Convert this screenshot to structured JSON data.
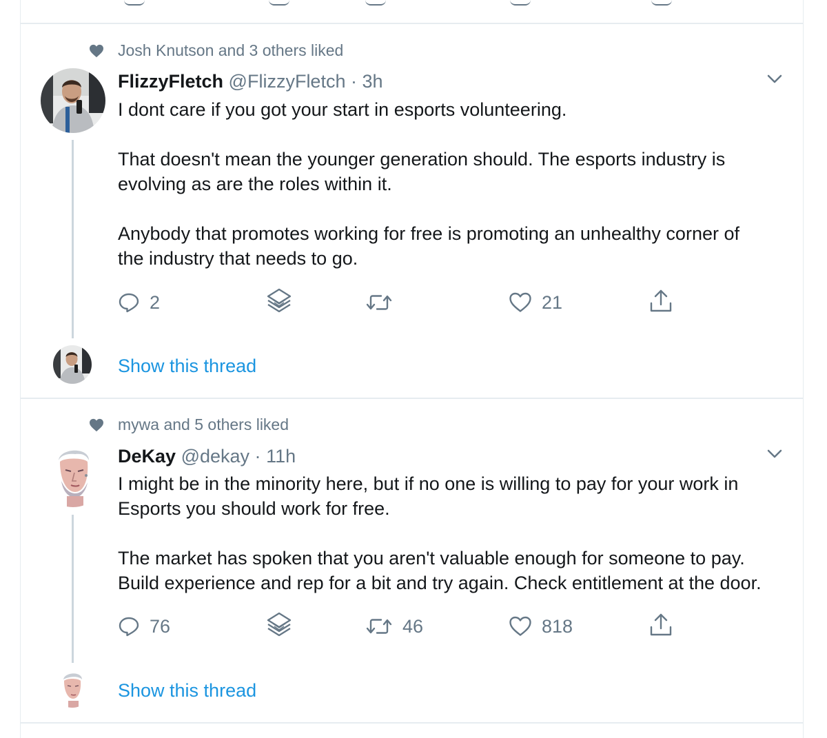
{
  "colors": {
    "link": "#1b95e0",
    "secondary_text": "#657786",
    "primary_text": "#14171a",
    "divider": "#e6ecf0",
    "thread_line": "#ccd6dd"
  },
  "tweets": [
    {
      "social_context": "Josh Knutson and 3 others liked",
      "name": "FlizzyFletch",
      "handle": "@FlizzyFletch",
      "separator": "·",
      "time": "3h",
      "text_lines": [
        "I dont care if you got your start in esports volunteering.",
        "",
        "That doesn't mean the younger generation should. The esports industry is",
        "evolving as are the roles within it.",
        "",
        "Anybody that promotes working for free is promoting an unhealthy corner of",
        "the industry that needs to go."
      ],
      "reply_count": "2",
      "retweet_count": "",
      "like_count": "21",
      "show_thread": "Show this thread"
    },
    {
      "social_context": "mywa and 5 others liked",
      "name": "DeKay",
      "handle": "@dekay",
      "separator": "·",
      "time": "11h",
      "text_lines": [
        "I might be in the minority here, but if no one is willing to pay for your work in",
        "Esports you should work for free.",
        "",
        "The market has spoken that you aren't valuable enough for someone to pay.",
        "Build experience and rep for a bit and try again. Check entitlement at the door."
      ],
      "reply_count": "76",
      "retweet_count": "46",
      "like_count": "818",
      "show_thread": "Show this thread"
    }
  ],
  "icons": {
    "social_context": "heart-solid-icon",
    "reply": "reply-icon",
    "stack": "layers-icon",
    "retweet": "retweet-icon",
    "like": "heart-outline-icon",
    "share": "share-icon",
    "caret": "chevron-down-icon"
  }
}
